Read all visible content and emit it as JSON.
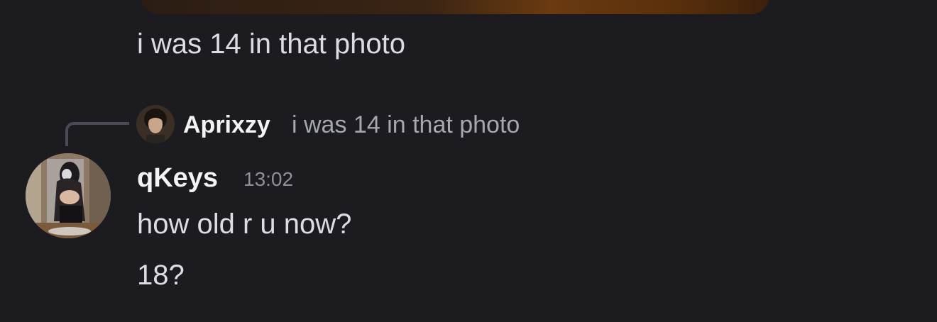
{
  "previous_message": {
    "text": "i was 14 in that photo"
  },
  "reply_reference": {
    "author": "Aprixzy",
    "text": "i was 14 in that photo"
  },
  "message": {
    "author": "qKeys",
    "timestamp": "13:02",
    "lines": [
      "how old r u now?",
      "18?"
    ]
  }
}
